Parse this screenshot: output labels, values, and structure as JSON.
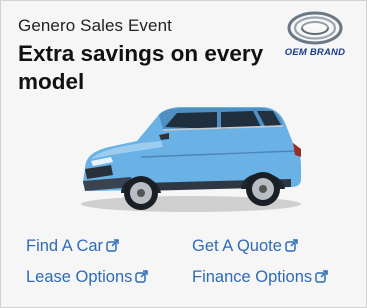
{
  "ad": {
    "eyebrow": "Genero Sales Event",
    "headline": "Extra savings on every model",
    "brand": "OEM BRAND",
    "car_color": "#6ab1e6",
    "link_color": "#2f6bb8"
  },
  "links": [
    {
      "label": "Find A Car",
      "icon": "external-link-icon"
    },
    {
      "label": "Get A Quote",
      "icon": "external-link-icon"
    },
    {
      "label": "Lease Options",
      "icon": "external-link-icon"
    },
    {
      "label": "Finance Options",
      "icon": "external-link-icon"
    }
  ]
}
